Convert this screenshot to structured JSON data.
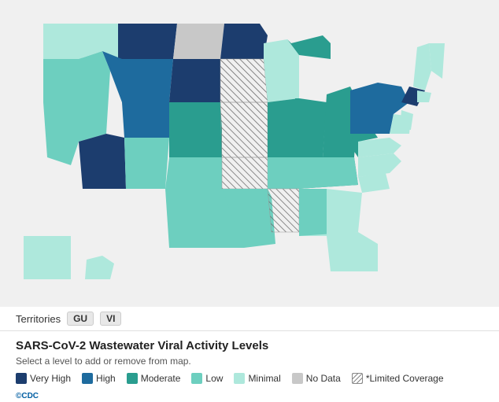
{
  "title": "SARS-CoV-2 Wastewater Viral Activity Levels",
  "subtitle": "Select a level to add or remove from map.",
  "territories_label": "Territories",
  "territories": [
    "GU",
    "VI"
  ],
  "legend": [
    {
      "id": "very-high",
      "label": "Very High",
      "color": "#1c3d6e"
    },
    {
      "id": "high",
      "label": "High",
      "color": "#1e6b9e"
    },
    {
      "id": "moderate",
      "label": "Moderate",
      "color": "#2a9d8f"
    },
    {
      "id": "low",
      "label": "Low",
      "color": "#6dcfbf"
    },
    {
      "id": "minimal",
      "label": "Minimal",
      "color": "#aee8dc"
    },
    {
      "id": "no-data",
      "label": "No Data",
      "color": "#c8c8c8"
    },
    {
      "id": "limited",
      "label": "*Limited Coverage",
      "color": "hatch"
    }
  ],
  "cdc_label": "©CDC"
}
